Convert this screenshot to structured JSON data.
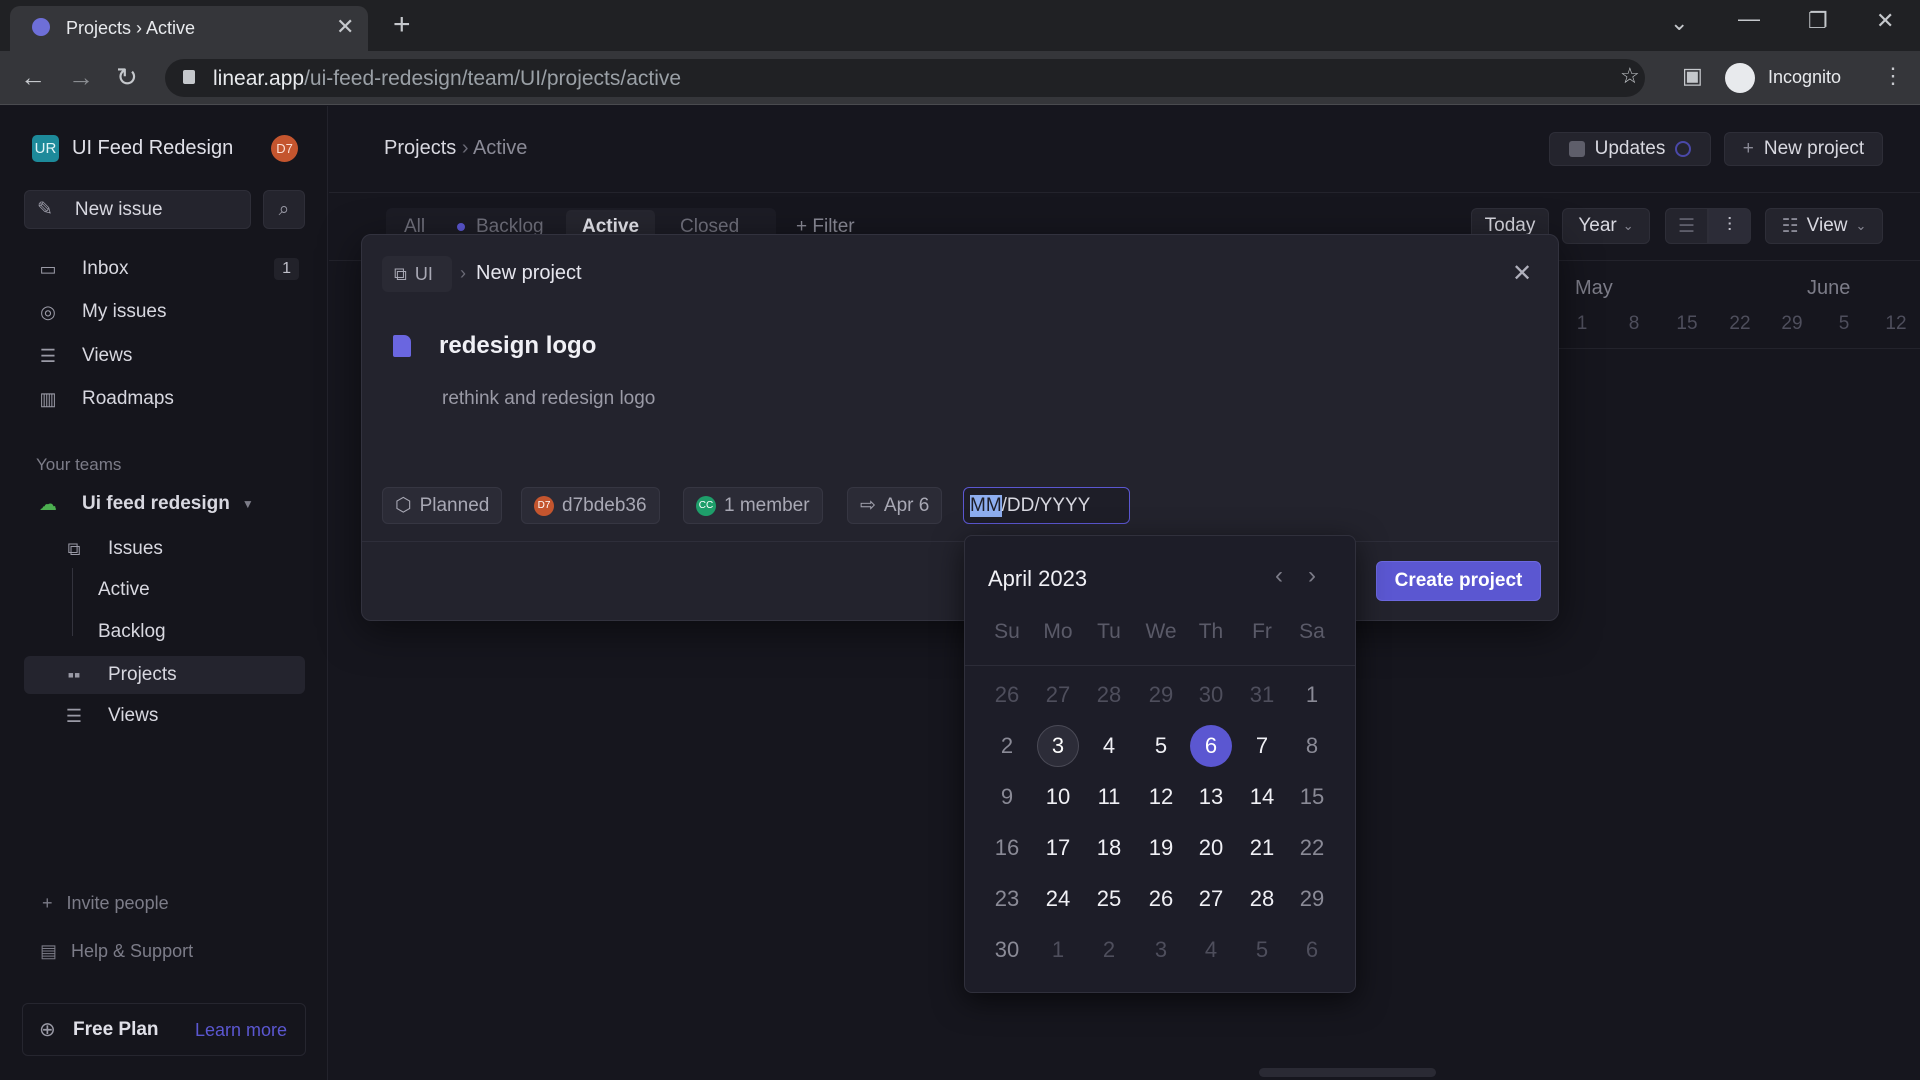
{
  "browser": {
    "tab_title": "Projects › Active",
    "url_host": "linear.app",
    "url_path": "/ui-feed-redesign/team/UI/projects/active",
    "profile": "Incognito"
  },
  "sidebar": {
    "workspace": "UI Feed Redesign",
    "workspace_initials": "UR",
    "user_initials": "D7",
    "new_issue": "New issue",
    "items": [
      {
        "label": "Inbox",
        "icon": "inbox-icon",
        "badge": "1"
      },
      {
        "label": "My issues",
        "icon": "target-icon"
      },
      {
        "label": "Views",
        "icon": "layers-icon"
      },
      {
        "label": "Roadmaps",
        "icon": "map-icon"
      }
    ],
    "teams_heading": "Your teams",
    "team": "Ui feed redesign",
    "team_items": [
      {
        "label": "Issues"
      },
      {
        "label": "Active"
      },
      {
        "label": "Backlog"
      },
      {
        "label": "Projects"
      },
      {
        "label": "Views"
      }
    ],
    "invite": "Invite people",
    "help": "Help & Support",
    "plan": "Free Plan",
    "learn_more": "Learn more"
  },
  "header": {
    "crumb_root": "Projects",
    "crumb_sep": "›",
    "crumb_current": "Active",
    "updates": "Updates",
    "new_project": "New project"
  },
  "filters": {
    "tabs": [
      "All",
      "Backlog",
      "Active",
      "Closed"
    ],
    "active_tab": "Active",
    "filter": "Filter",
    "today": "Today",
    "year": "Year",
    "view": "View"
  },
  "timeline": {
    "months": [
      "May",
      "June"
    ],
    "weeks": [
      "1",
      "8",
      "15",
      "22",
      "29",
      "5",
      "12"
    ]
  },
  "modal": {
    "team": "UI",
    "sep": "›",
    "title": "New project",
    "project_name": "redesign logo",
    "description": "rethink and redesign logo",
    "chips": {
      "status": "Planned",
      "lead": "d7bdeb36",
      "lead_initials": "D7",
      "members": "1 member",
      "members_initials": "CC",
      "start": "Apr 6"
    },
    "date_input": {
      "selected": "MM",
      "rest": "/DD/YYYY"
    },
    "create": "Create project"
  },
  "calendar": {
    "month": "April 2023",
    "weekdays": [
      "Su",
      "Mo",
      "Tu",
      "We",
      "Th",
      "Fr",
      "Sa"
    ],
    "selected_day": 6,
    "today": 3,
    "weeks": [
      [
        [
          "26",
          "o"
        ],
        [
          "27",
          "o"
        ],
        [
          "28",
          "o"
        ],
        [
          "29",
          "o"
        ],
        [
          "30",
          "o"
        ],
        [
          "31",
          "o"
        ],
        [
          "1",
          "w"
        ]
      ],
      [
        [
          "2",
          "w"
        ],
        [
          "3",
          "t"
        ],
        [
          "4",
          "d"
        ],
        [
          "5",
          "d"
        ],
        [
          "6",
          "s"
        ],
        [
          "7",
          "d"
        ],
        [
          "8",
          "w"
        ]
      ],
      [
        [
          "9",
          "w"
        ],
        [
          "10",
          "d"
        ],
        [
          "11",
          "d"
        ],
        [
          "12",
          "d"
        ],
        [
          "13",
          "d"
        ],
        [
          "14",
          "d"
        ],
        [
          "15",
          "w"
        ]
      ],
      [
        [
          "16",
          "w"
        ],
        [
          "17",
          "d"
        ],
        [
          "18",
          "d"
        ],
        [
          "19",
          "d"
        ],
        [
          "20",
          "d"
        ],
        [
          "21",
          "d"
        ],
        [
          "22",
          "w"
        ]
      ],
      [
        [
          "23",
          "w"
        ],
        [
          "24",
          "d"
        ],
        [
          "25",
          "d"
        ],
        [
          "26",
          "d"
        ],
        [
          "27",
          "d"
        ],
        [
          "28",
          "d"
        ],
        [
          "29",
          "w"
        ]
      ],
      [
        [
          "30",
          "w"
        ],
        [
          "1",
          "o"
        ],
        [
          "2",
          "o"
        ],
        [
          "3",
          "o"
        ],
        [
          "4",
          "o"
        ],
        [
          "5",
          "o"
        ],
        [
          "6",
          "o"
        ]
      ]
    ]
  },
  "colors": {
    "accent": "#5b57d1",
    "background": "#16161e",
    "modal": "#23232d"
  }
}
